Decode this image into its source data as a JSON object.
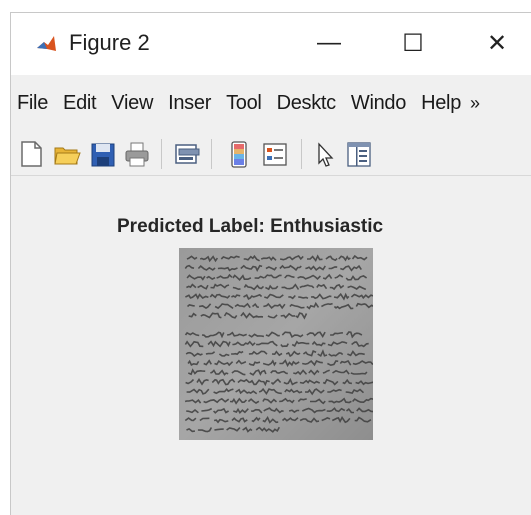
{
  "window": {
    "title": "Figure 2",
    "controls": {
      "minimize": "—",
      "maximize": "☐",
      "close": "✕"
    }
  },
  "menubar": {
    "items": [
      "File",
      "Edit",
      "View",
      "Inser",
      "Tool",
      "Desktc",
      "Windo",
      "Help"
    ],
    "overflow": "»"
  },
  "toolbar": {
    "icons": [
      "new-figure-icon",
      "open-file-icon",
      "save-icon",
      "print-icon",
      "link-plot-icon",
      "insert-colorbar-icon",
      "insert-legend-icon",
      "edit-plot-icon",
      "property-inspector-icon"
    ]
  },
  "figure": {
    "title": "Predicted Label: Enthusiastic"
  },
  "colors": {
    "window_bg": "#f0f0f0",
    "titlebar_bg": "#ffffff",
    "image_bg": "#8c8c8c"
  }
}
